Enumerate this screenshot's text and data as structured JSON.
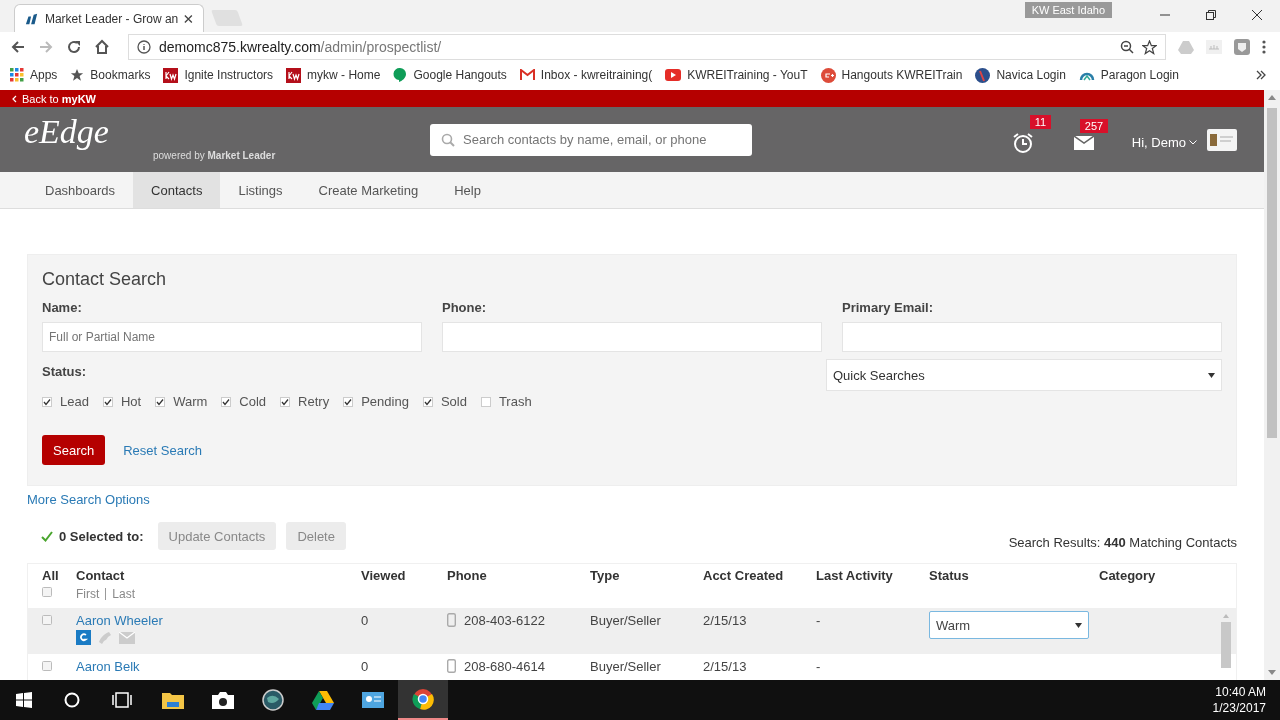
{
  "browser": {
    "tab_title": "Market Leader - Grow an",
    "profile": "KW East Idaho",
    "url_host": "demomc875.kwrealty.com",
    "url_path": "/admin/prospectlist/"
  },
  "bookmarks": [
    {
      "label": "Apps",
      "kind": "apps"
    },
    {
      "label": "Bookmarks",
      "kind": "star"
    },
    {
      "label": "Ignite Instructors",
      "kind": "kw"
    },
    {
      "label": "mykw - Home",
      "kind": "kw"
    },
    {
      "label": "Google Hangouts",
      "kind": "hangouts"
    },
    {
      "label": "Inbox - kwreitraining(",
      "kind": "gmail"
    },
    {
      "label": "KWREITraining - YouT",
      "kind": "youtube"
    },
    {
      "label": "Hangouts KWREITrain",
      "kind": "gplus"
    },
    {
      "label": "Navica Login",
      "kind": "navica"
    },
    {
      "label": "Paragon Login",
      "kind": "paragon"
    }
  ],
  "back_link": "Back to **myKW**",
  "header": {
    "logo": "eEdge",
    "powered": "powered by **Market Leader**",
    "search_placeholder": "Search contacts by name, email, or phone",
    "alarm_count": "11",
    "mail_count": "257",
    "greeting": "Hi, Demo"
  },
  "nav": [
    {
      "label": "Dashboards",
      "selected": false
    },
    {
      "label": "Contacts",
      "selected": true
    },
    {
      "label": "Listings",
      "selected": false
    },
    {
      "label": "Create Marketing",
      "selected": false
    },
    {
      "label": "Help",
      "selected": false
    }
  ],
  "contact_search": {
    "title": "Contact Search",
    "fields": [
      {
        "label": "Name:",
        "placeholder": "Full or Partial Name"
      },
      {
        "label": "Phone:"
      },
      {
        "label": "Primary Email:"
      }
    ],
    "status_label": "Status:",
    "statuses": [
      {
        "label": "Lead",
        "checked": true
      },
      {
        "label": "Hot",
        "checked": true
      },
      {
        "label": "Warm",
        "checked": true
      },
      {
        "label": "Cold",
        "checked": true
      },
      {
        "label": "Retry",
        "checked": true
      },
      {
        "label": "Pending",
        "checked": true
      },
      {
        "label": "Sold",
        "checked": true
      },
      {
        "label": "Trash",
        "checked": false
      }
    ],
    "quick_searches": "Quick Searches",
    "search_button": "Search",
    "reset_link": "Reset Search"
  },
  "more_options": "More Search Options",
  "selection": {
    "count_text": "0 Selected to:",
    "buttons": [
      {
        "label": "Update Contacts",
        "disabled": true
      },
      {
        "label": "Delete",
        "disabled": true
      }
    ],
    "results": "Search Results: **440** Matching Contacts"
  },
  "table": {
    "columns": [
      "All",
      "Contact",
      "Viewed",
      "Phone",
      "Type",
      "Acct Created",
      "Last Activity",
      "Status",
      "Category"
    ],
    "sub_labels": [
      "First",
      "Last"
    ],
    "all_checked": false,
    "rows": [
      {
        "name": "Aaron Wheeler",
        "viewed": "0",
        "phone": "208-403-6122",
        "type": "Buyer/Seller",
        "created": "2/15/13",
        "last_activity": "-",
        "status": "Warm",
        "checked": false,
        "highlighted": true,
        "show_icons": true
      },
      {
        "name": "Aaron Belk",
        "viewed": "0",
        "phone": "208-680-4614",
        "type": "Buyer/Seller",
        "created": "2/15/13",
        "last_activity": "-",
        "checked": false,
        "highlighted": false,
        "show_icons": false
      }
    ]
  },
  "taskbar": {
    "apps": [
      {
        "kind": "explorer",
        "active": false
      },
      {
        "kind": "camera",
        "active": false
      },
      {
        "kind": "globe",
        "active": false
      },
      {
        "kind": "drive",
        "active": false
      },
      {
        "kind": "card",
        "active": false
      },
      {
        "kind": "chrome",
        "active": true
      }
    ],
    "time": "10:40 AM",
    "date": "1/23/2017"
  }
}
